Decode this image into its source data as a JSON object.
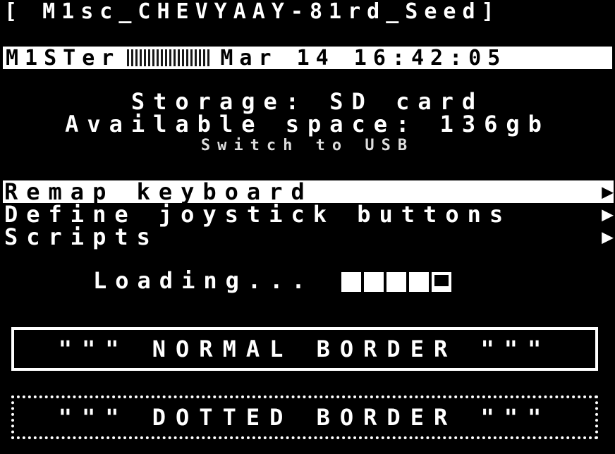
{
  "window": {
    "title": "[ M1sc_CHEVYAAY-81rd_Seed]"
  },
  "statusbar": {
    "left_text": "M1STer",
    "right_text": "Mar 14 16:42:05",
    "icons": "status-icons"
  },
  "info": {
    "storage": "Storage: SD card",
    "space": "Available space: 136gb",
    "subtitle": "Switch to USB"
  },
  "menu": {
    "items": [
      {
        "label": "Remap keyboard",
        "arrow": "▶",
        "selected": true
      },
      {
        "label": "Define joystick buttons",
        "arrow": "▶",
        "selected": false
      },
      {
        "label": "Scripts",
        "arrow": "▶",
        "selected": false
      }
    ]
  },
  "loading": {
    "label": "Loading...",
    "progress_blocks_total": 5,
    "progress_blocks_filled": 4
  },
  "boxes": {
    "normal": "\"\"\" NORMAL BORDER \"\"\"",
    "dotted": "\"\"\" DOTTED BORDER \"\"\""
  },
  "colors": {
    "background": "#000000",
    "foreground": "#ffffff"
  }
}
